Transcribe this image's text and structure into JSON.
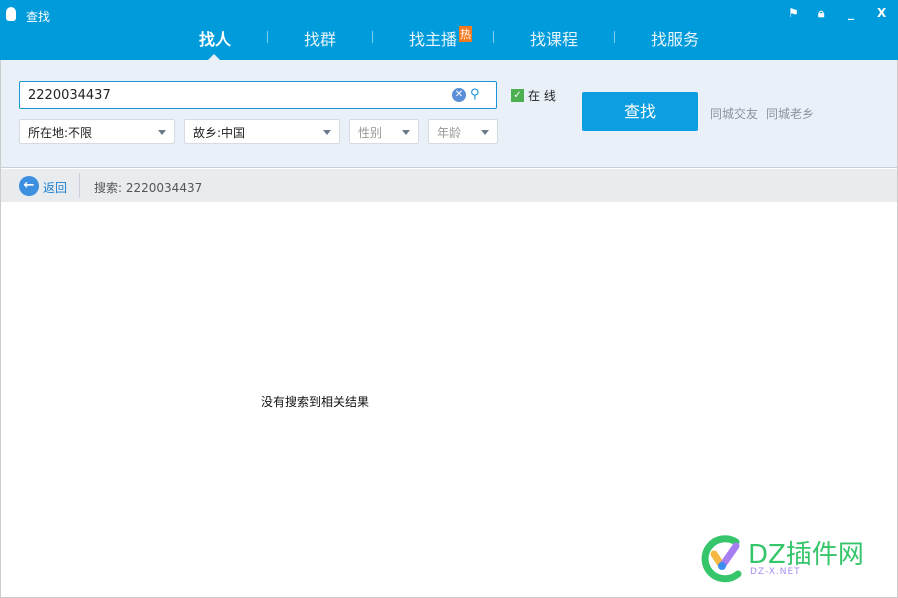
{
  "window": {
    "title": "查找",
    "controls": [
      "feedback",
      "lock",
      "minimize",
      "close"
    ]
  },
  "tabs": [
    {
      "label": "找人",
      "active": true
    },
    {
      "label": "找群"
    },
    {
      "label": "找主播",
      "badge": "热"
    },
    {
      "label": "找课程"
    },
    {
      "label": "找服务"
    }
  ],
  "search": {
    "value": "2220034437",
    "online_label": "在 线",
    "online_checked": true,
    "button": "查找",
    "filters": [
      {
        "label": "所在地:不限"
      },
      {
        "label": "故乡:中国"
      },
      {
        "label": "性别",
        "placeholder": true
      },
      {
        "label": "年龄",
        "placeholder": true
      }
    ],
    "links": [
      "同城交友",
      "同城老乡"
    ]
  },
  "nav": {
    "back": "返回",
    "query_label": "搜索:",
    "query": "2220034437"
  },
  "result": {
    "empty": "没有搜索到相关结果"
  },
  "watermark": {
    "text": "DZ插件网",
    "sub": "DZ-X.NET"
  },
  "colors": {
    "brand": "#009bdb",
    "button": "#0c9ee0",
    "hot": "#f47a20"
  }
}
